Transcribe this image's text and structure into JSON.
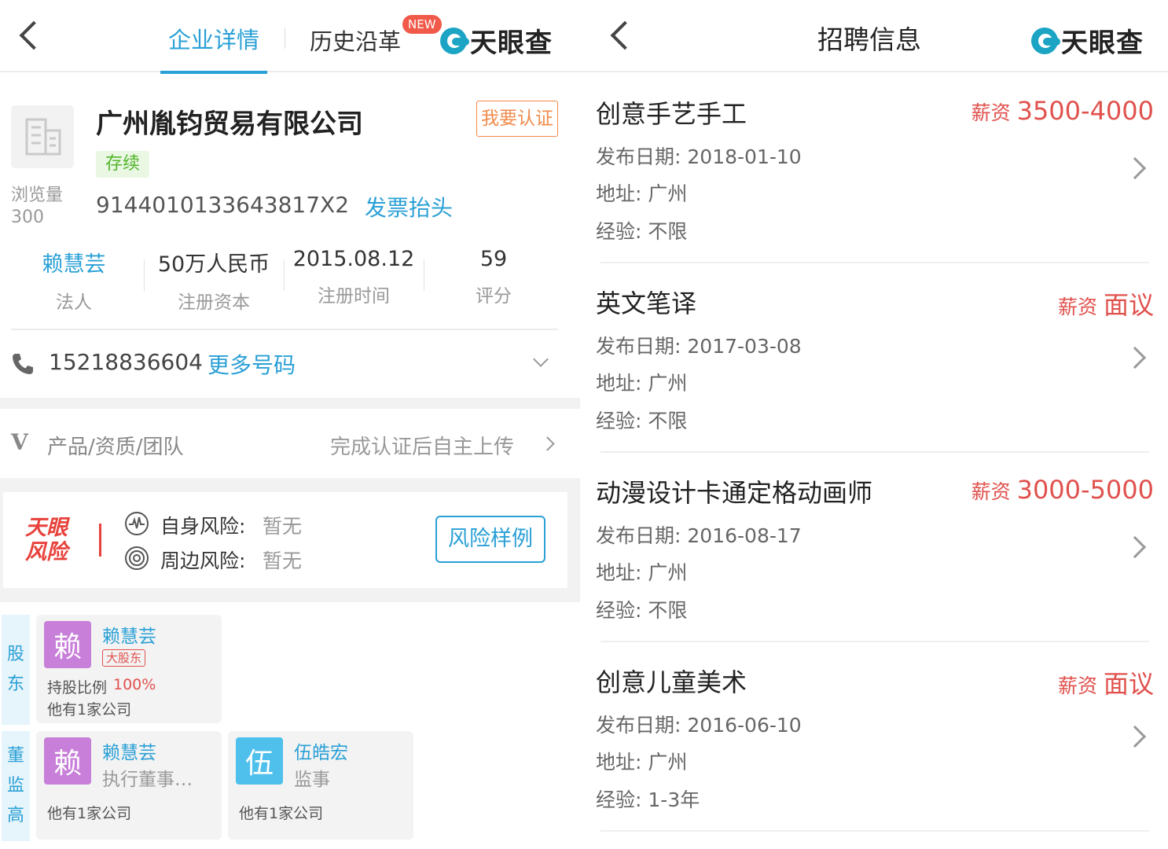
{
  "left": {
    "tabs": {
      "detail": "企业详情",
      "history": "历史沿革",
      "new_badge": "NEW"
    },
    "logo_text": "天眼查",
    "company": {
      "name": "广州胤钧贸易有限公司",
      "certify_button": "我要认证",
      "status": "存续",
      "views_label": "浏览量",
      "views_value": "300",
      "credit_code": "9144010133643817X2",
      "invoice_link": "发票抬头"
    },
    "stats": [
      {
        "value": "赖慧芸",
        "label": "法人"
      },
      {
        "value": "50万人民币",
        "label": "注册资本"
      },
      {
        "value": "2015.08.12",
        "label": "注册时间"
      },
      {
        "value": "59",
        "label": "评分"
      }
    ],
    "phone": {
      "number": "15218836604",
      "more": "更多号码"
    },
    "product": {
      "badge": "V",
      "label": "产品/资质/团队",
      "hint": "完成认证后自主上传"
    },
    "risk": {
      "logo_line1": "天眼",
      "logo_line2": "风险",
      "self_label": "自身风险:",
      "self_value": "暂无",
      "around_label": "周边风险:",
      "around_value": "暂无",
      "sample_button": "风险样例"
    },
    "shareholders": {
      "section_chars": [
        "股",
        "东"
      ],
      "items": [
        {
          "avatar": "赖",
          "name": "赖慧芸",
          "tag": "大股东",
          "ratio_label": "持股比例",
          "ratio": "100%",
          "companies": "他有1家公司"
        }
      ]
    },
    "executives": {
      "section_chars": [
        "董",
        "监",
        "高"
      ],
      "items": [
        {
          "avatar": "赖",
          "name": "赖慧芸",
          "role": "执行董事…",
          "companies": "他有1家公司"
        },
        {
          "avatar": "伍",
          "name": "伍皓宏",
          "role": "监事",
          "companies": "他有1家公司"
        }
      ]
    }
  },
  "right": {
    "title": "招聘信息",
    "logo_text": "天眼查",
    "jobs": [
      {
        "title": "创意手艺手工",
        "salary_label": "薪资",
        "salary": "3500-4000",
        "date_label": "发布日期:",
        "date": "2018-01-10",
        "addr_label": "地址:",
        "addr": "广州",
        "exp_label": "经验:",
        "exp": "不限"
      },
      {
        "title": "英文笔译",
        "salary_label": "薪资",
        "salary": "面议",
        "date_label": "发布日期:",
        "date": "2017-03-08",
        "addr_label": "地址:",
        "addr": "广州",
        "exp_label": "经验:",
        "exp": "不限"
      },
      {
        "title": "动漫设计卡通定格动画师",
        "salary_label": "薪资",
        "salary": "3000-5000",
        "date_label": "发布日期:",
        "date": "2016-08-17",
        "addr_label": "地址:",
        "addr": "广州",
        "exp_label": "经验:",
        "exp": "不限"
      },
      {
        "title": "创意儿童美术",
        "salary_label": "薪资",
        "salary": "面议",
        "date_label": "发布日期:",
        "date": "2016-06-10",
        "addr_label": "地址:",
        "addr": "广州",
        "exp_label": "经验:",
        "exp": "1-3年"
      }
    ]
  },
  "colors": {
    "accent": "#2aa0d6",
    "salary": "#e0514d",
    "status_green": "#52b52a",
    "certify_orange": "#f08a4b",
    "avatar_purple": "#c87fd9",
    "avatar_blue": "#4fc0ec"
  }
}
